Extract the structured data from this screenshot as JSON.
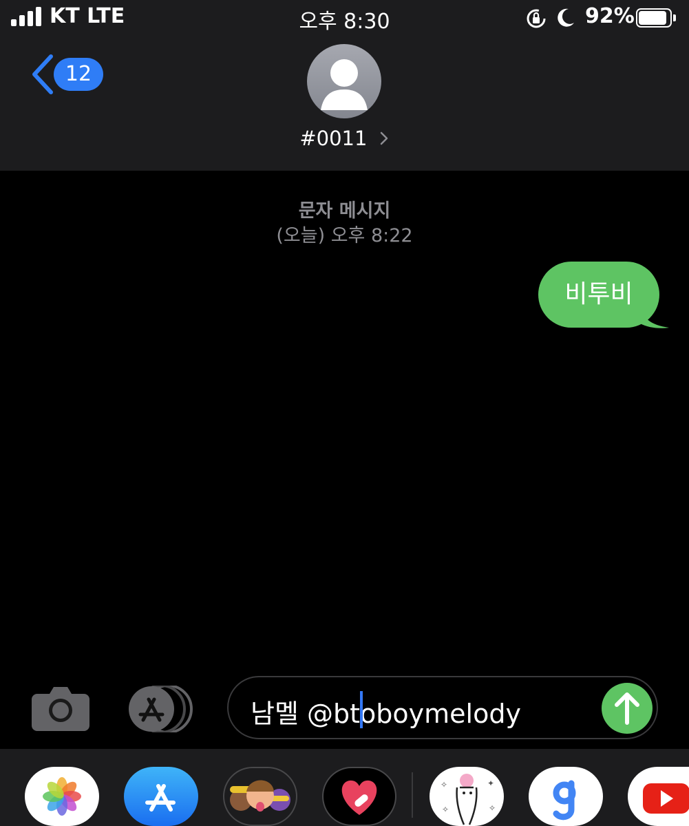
{
  "status_bar": {
    "carrier": "KT LTE",
    "time": "오후 8:30",
    "battery_percent": "92%",
    "battery_level": 0.92,
    "icons": [
      "signal-icon",
      "rotation-lock-icon",
      "moon-icon",
      "battery-icon"
    ]
  },
  "header": {
    "back_badge": "12",
    "contact_name": "#0011",
    "icons": [
      "chevron-left-icon",
      "person-icon",
      "chevron-right-icon"
    ]
  },
  "conversation": {
    "label": "문자 메시지",
    "timestamp": "(오늘) 오후 8:22",
    "messages": [
      {
        "text": "비투비",
        "direction": "outgoing"
      }
    ]
  },
  "input_bar": {
    "value": "남멜 @btoboymelody",
    "icons": [
      "camera-icon",
      "app-store-icon",
      "send-arrow-icon"
    ]
  },
  "app_tray": {
    "apps": [
      "photos",
      "app-store",
      "memoji",
      "digital-touch",
      "sticker",
      "gboard",
      "youtube"
    ]
  },
  "colors": {
    "accent": "#2f7df6",
    "sms_green": "#5ec463",
    "bar_background": "#1c1c1e",
    "meta_text": "#8e8e93"
  }
}
